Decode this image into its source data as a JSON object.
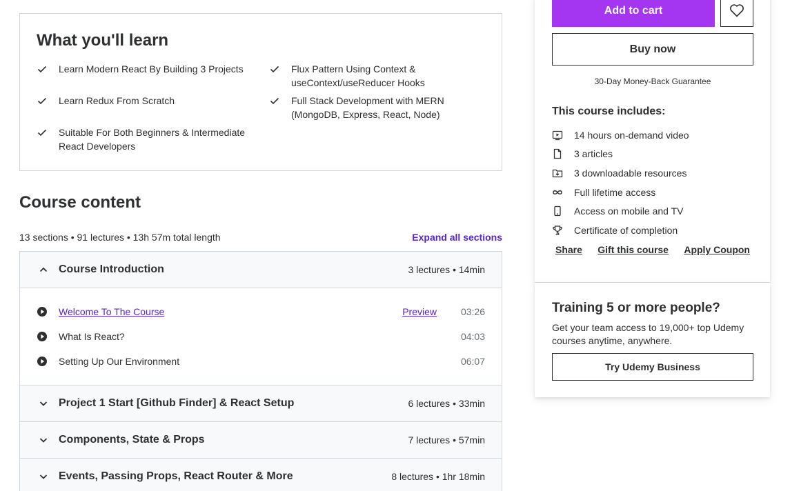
{
  "learn": {
    "title": "What you'll learn",
    "items": [
      "Learn Modern React By Building 3 Projects",
      "Flux Pattern Using Context & useContext/useReducer Hooks",
      "Learn Redux From Scratch",
      "Full Stack Development with MERN (MongoDB, Express, React, Node)",
      "Suitable For Both Beginners & Intermediate React Developers"
    ]
  },
  "course_content": {
    "title": "Course content",
    "meta": "13 sections • 91 lectures • 13h 57m total length",
    "expand_all": "Expand all sections",
    "sections": [
      {
        "title": "Course Introduction",
        "stats": "3 lectures • 14min",
        "expanded": true,
        "lectures": [
          {
            "title": "Welcome To The Course",
            "preview": "Preview",
            "duration": "03:26"
          },
          {
            "title": "What Is React?",
            "preview": "",
            "duration": "04:03"
          },
          {
            "title": "Setting Up Our Environment",
            "preview": "",
            "duration": "06:07"
          }
        ]
      },
      {
        "title": "Project 1 Start [Github Finder] & React Setup",
        "stats": "6 lectures • 33min",
        "expanded": false
      },
      {
        "title": "Components, State & Props",
        "stats": "7 lectures • 57min",
        "expanded": false
      },
      {
        "title": "Events, Passing Props, React Router & More",
        "stats": "8 lectures • 1hr 18min",
        "expanded": false
      }
    ]
  },
  "sidebar": {
    "add_to_cart": "Add to cart",
    "buy_now": "Buy now",
    "guarantee": "30-Day Money-Back Guarantee",
    "includes_title": "This course includes:",
    "includes": [
      {
        "icon": "video-icon",
        "label": "14 hours on-demand video"
      },
      {
        "icon": "file-icon",
        "label": "3 articles"
      },
      {
        "icon": "download-icon",
        "label": "3 downloadable resources"
      },
      {
        "icon": "infinity-icon",
        "label": "Full lifetime access"
      },
      {
        "icon": "mobile-icon",
        "label": "Access on mobile and TV"
      },
      {
        "icon": "trophy-icon",
        "label": "Certificate of completion"
      }
    ],
    "share": "Share",
    "gift": "Gift this course",
    "coupon": "Apply Coupon"
  },
  "business": {
    "title": "Training 5 or more people?",
    "description": "Get your team access to 19,000+ top Udemy courses anytime, anywhere.",
    "button": "Try Udemy Business"
  },
  "colors": {
    "accent": "#a435f0",
    "link": "#5624d0",
    "text": "#2d2f31",
    "border": "#d1d7dc",
    "section_bg": "#f7f9fa"
  }
}
